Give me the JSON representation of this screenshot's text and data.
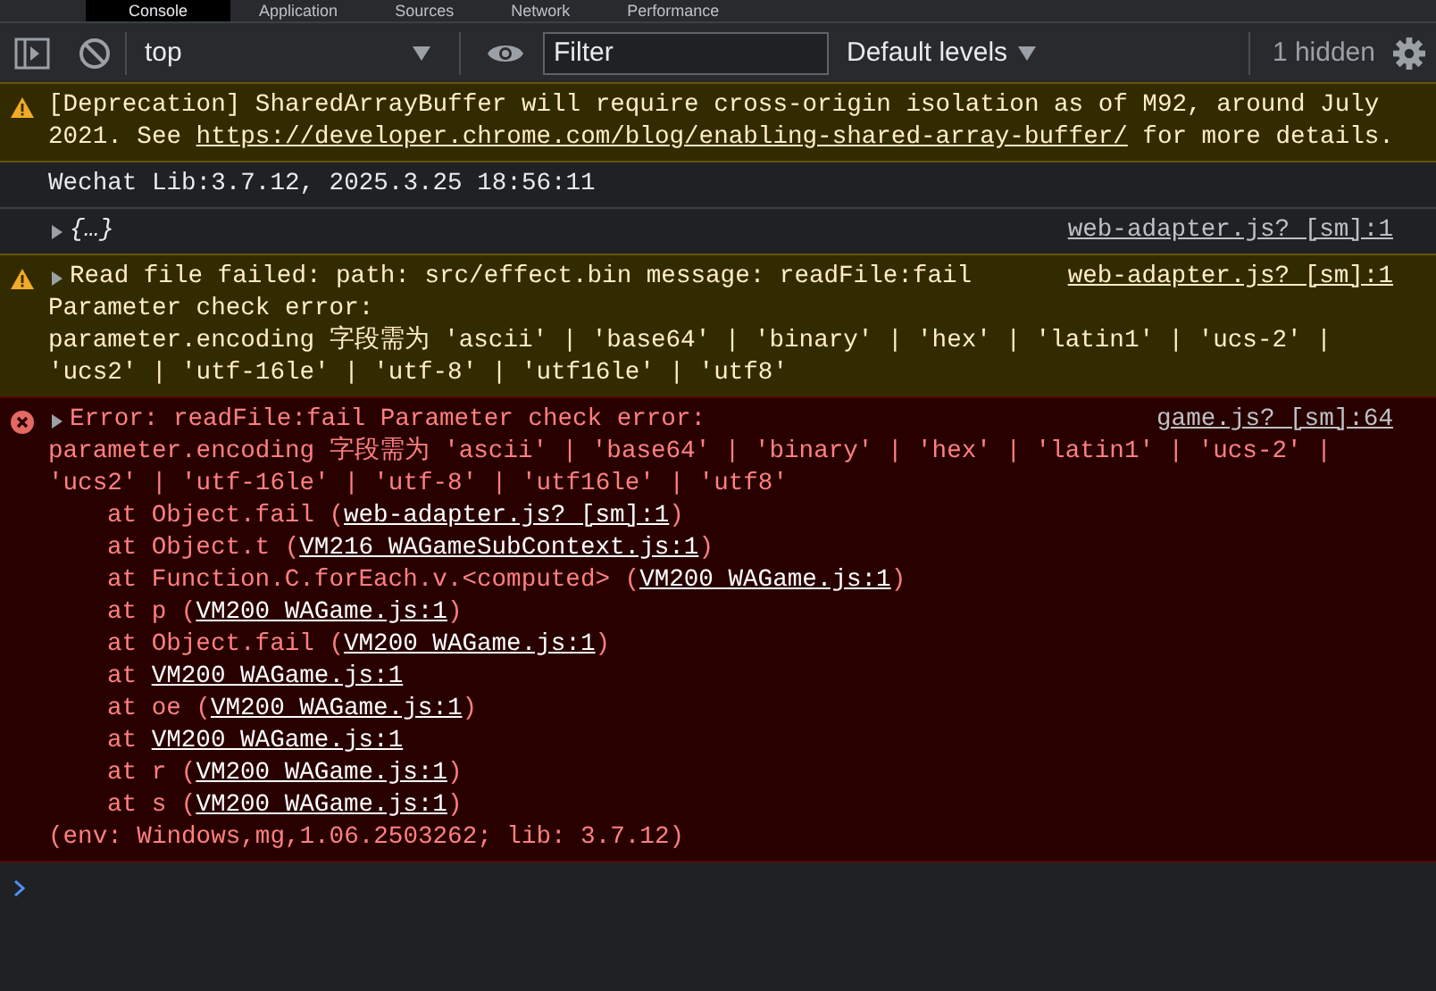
{
  "tabs": [
    {
      "label": "Console",
      "selected": true
    },
    {
      "label": "Application",
      "selected": false
    },
    {
      "label": "Sources",
      "selected": false
    },
    {
      "label": "Network",
      "selected": false
    },
    {
      "label": "Performance",
      "selected": false
    }
  ],
  "toolbar": {
    "context": "top",
    "filter": {
      "placeholder": "Filter"
    },
    "levels": "Default levels",
    "hidden_count": "1 hidden"
  },
  "messages": [
    {
      "kind": "warning",
      "expandable": false,
      "parts": [
        {
          "text": "[Deprecation] SharedArrayBuffer will require cross-origin isolation as of M92, around July 2021. See "
        },
        {
          "link": "https://developer.chrome.com/blog/enabling-shared-array-buffer/"
        },
        {
          "text": " for more details."
        }
      ]
    },
    {
      "kind": "info",
      "expandable": false,
      "summary": "Wechat Lib:3.7.12, 2025.3.25 18:56:11"
    },
    {
      "kind": "object",
      "expandable": true,
      "summary": "{…}",
      "source": "web-adapter.js? [sm]:1"
    },
    {
      "kind": "warning",
      "expandable": true,
      "summary": "Read file failed: path: src/effect.bin message: readFile:fail",
      "source": "web-adapter.js? [sm]:1",
      "lines": [
        "Parameter check error:",
        "parameter.encoding 字段需为 'ascii' | 'base64' | 'binary' | 'hex' | 'latin1' | 'ucs-2' |",
        "'ucs2' | 'utf-16le' | 'utf-8' | 'utf16le' | 'utf8'"
      ]
    },
    {
      "kind": "error",
      "expandable": true,
      "summary": "Error: readFile:fail Parameter check error:",
      "source": "game.js? [sm]:64",
      "lines": [
        "parameter.encoding 字段需为 'ascii' | 'base64' | 'binary' | 'hex' | 'latin1' | 'ucs-2' |",
        "'ucs2' | 'utf-16le' | 'utf-8' | 'utf16le' | 'utf8'"
      ],
      "stack": [
        {
          "before": "at Object.fail (",
          "link": "web-adapter.js? [sm]:1",
          "after": ")"
        },
        {
          "before": "at Object.t (",
          "link": "VM216 WAGameSubContext.js:1",
          "after": ")"
        },
        {
          "before": "at Function.C.forEach.v.<computed> (",
          "link": "VM200 WAGame.js:1",
          "after": ")"
        },
        {
          "before": "at p (",
          "link": "VM200 WAGame.js:1",
          "after": ")"
        },
        {
          "before": "at Object.fail (",
          "link": "VM200 WAGame.js:1",
          "after": ")"
        },
        {
          "before": "at ",
          "link": "VM200 WAGame.js:1"
        },
        {
          "before": "at oe (",
          "link": "VM200 WAGame.js:1",
          "after": ")"
        },
        {
          "before": "at ",
          "link": "VM200 WAGame.js:1"
        },
        {
          "before": "at r (",
          "link": "VM200 WAGame.js:1",
          "after": ")"
        },
        {
          "before": "at s (",
          "link": "VM200 WAGame.js:1",
          "after": ")"
        }
      ],
      "footer": "(env: Windows,mg,1.06.2503262; lib: 3.7.12)"
    }
  ]
}
